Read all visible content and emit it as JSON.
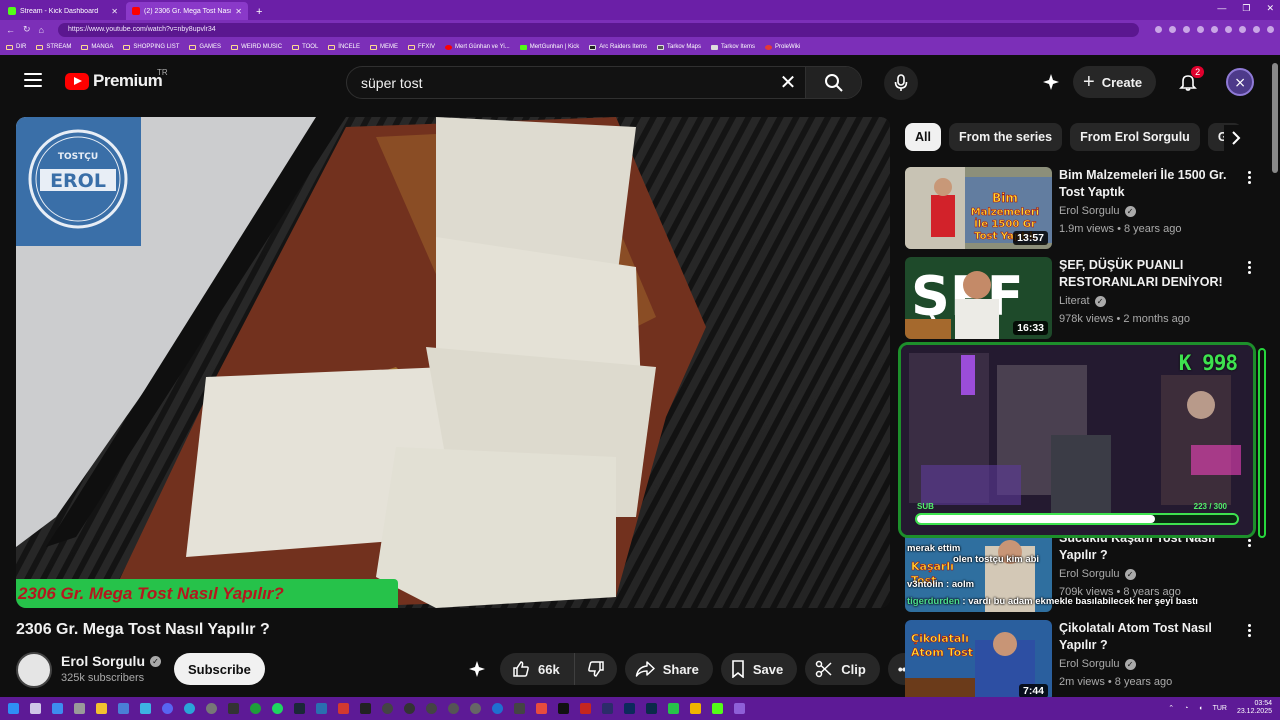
{
  "browser": {
    "tabs": [
      {
        "title": "Stream - Kick Dashboard",
        "active": false,
        "color": "#53fc18"
      },
      {
        "title": "(2) 2306 Gr. Mega Tost Nasıl Y...",
        "active": true,
        "color": "#ff0000"
      }
    ],
    "url": "https://www.youtube.com/watch?v=nby8upvlr34",
    "bookmarks": [
      "DIR",
      "STREAM",
      "MANGA",
      "SHOPPING LIST",
      "GAMES",
      "WEIRD MUSIC",
      "TOOL",
      "İNCELE",
      "MEME",
      "FFXIV",
      "Mert Günhan ve Yi...",
      "MertGunhan | Kick",
      "Arc Raiders Items",
      "Tarkov Maps",
      "Tarkov Items",
      "ProleWiki"
    ]
  },
  "header": {
    "logo_text": "Premium",
    "region": "TR",
    "search_query": "süper tost",
    "create_label": "Create",
    "notification_count": "2"
  },
  "video": {
    "banner_text": "2306 Gr. Mega Tost Nasıl Yapılır?",
    "title": "2306 Gr. Mega Tost Nasıl Yapılır ?",
    "channel": "Erol Sorgulu",
    "subscribers": "325k subscribers",
    "subscribe_label": "Subscribe",
    "likes": "66k",
    "share_label": "Share",
    "save_label": "Save",
    "clip_label": "Clip"
  },
  "sidebar": {
    "chips": [
      "All",
      "From the series",
      "From Erol Sorgulu",
      "Gr"
    ],
    "recommendations": [
      {
        "title": "Bim Malzemeleri İle 1500 Gr. Tost Yaptık",
        "channel": "Erol Sorgulu",
        "meta": "1.9m views • 8 years ago",
        "duration": "13:57",
        "verified": true
      },
      {
        "title": "ŞEF, DÜŞÜK PUANLI RESTORANLARI DENİYOR!",
        "channel": "Literat",
        "meta": "978k views • 2 months ago",
        "duration": "16:33",
        "verified": true
      },
      {
        "title": "Sucuklu Kaşarlı Tost Nasıl Yapılır ?",
        "channel": "Erol Sorgulu",
        "meta": "709k views • 8 years ago",
        "duration": "",
        "verified": true
      },
      {
        "title": "Çikolatalı Atom Tost Nasıl Yapılır ?",
        "channel": "Erol Sorgulu",
        "meta": "2m views • 8 years ago",
        "duration": "7:44",
        "verified": true
      }
    ]
  },
  "stream_overlay": {
    "counter": "K 998",
    "sub_label": "SUB",
    "goal_text": "223 / 300",
    "goal_progress": 0.743
  },
  "chat": [
    {
      "user": "",
      "text": "merak ettim"
    },
    {
      "user": "",
      "text": "olen tostçu kim abi"
    },
    {
      "user": "",
      "text": "v3ntolin : aolm"
    },
    {
      "user": "tigerdurden",
      "text": ": vardı bu adam ekmekle basılabilecek her şeyi bastı"
    }
  ],
  "taskbar": {
    "lang": "TUR",
    "time": "03:54",
    "date": "23.12.2025"
  }
}
